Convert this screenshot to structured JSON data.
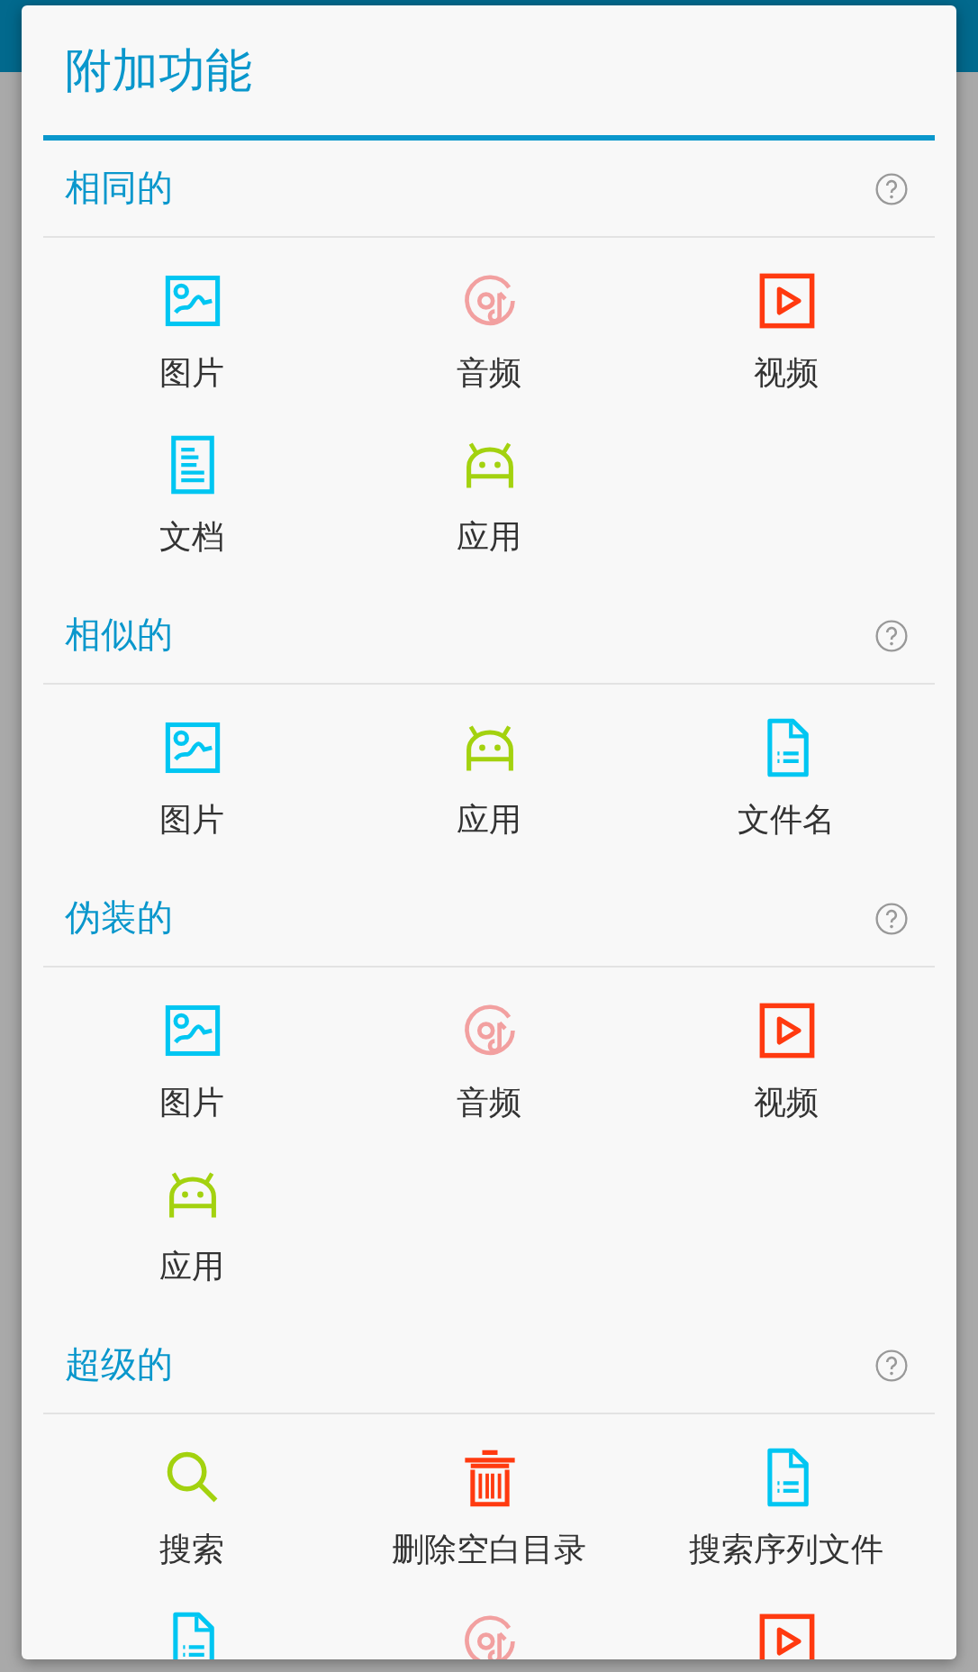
{
  "dialog": {
    "title": "附加功能"
  },
  "sections": [
    {
      "title": "相同的",
      "items": [
        {
          "kind": "image",
          "label": "图片"
        },
        {
          "kind": "audio",
          "label": "音频"
        },
        {
          "kind": "video",
          "label": "视频"
        },
        {
          "kind": "document",
          "label": "文档"
        },
        {
          "kind": "app",
          "label": "应用"
        }
      ]
    },
    {
      "title": "相似的",
      "items": [
        {
          "kind": "image",
          "label": "图片"
        },
        {
          "kind": "app",
          "label": "应用"
        },
        {
          "kind": "file",
          "label": "文件名"
        }
      ]
    },
    {
      "title": "伪装的",
      "items": [
        {
          "kind": "image",
          "label": "图片"
        },
        {
          "kind": "audio",
          "label": "音频"
        },
        {
          "kind": "video",
          "label": "视频"
        },
        {
          "kind": "app",
          "label": "应用"
        }
      ]
    },
    {
      "title": "超级的",
      "items": [
        {
          "kind": "search",
          "label": "搜索"
        },
        {
          "kind": "trash",
          "label": "删除空白目录"
        },
        {
          "kind": "file",
          "label": "搜索序列文件"
        },
        {
          "kind": "file"
        },
        {
          "kind": "audio"
        },
        {
          "kind": "video"
        }
      ]
    }
  ]
}
